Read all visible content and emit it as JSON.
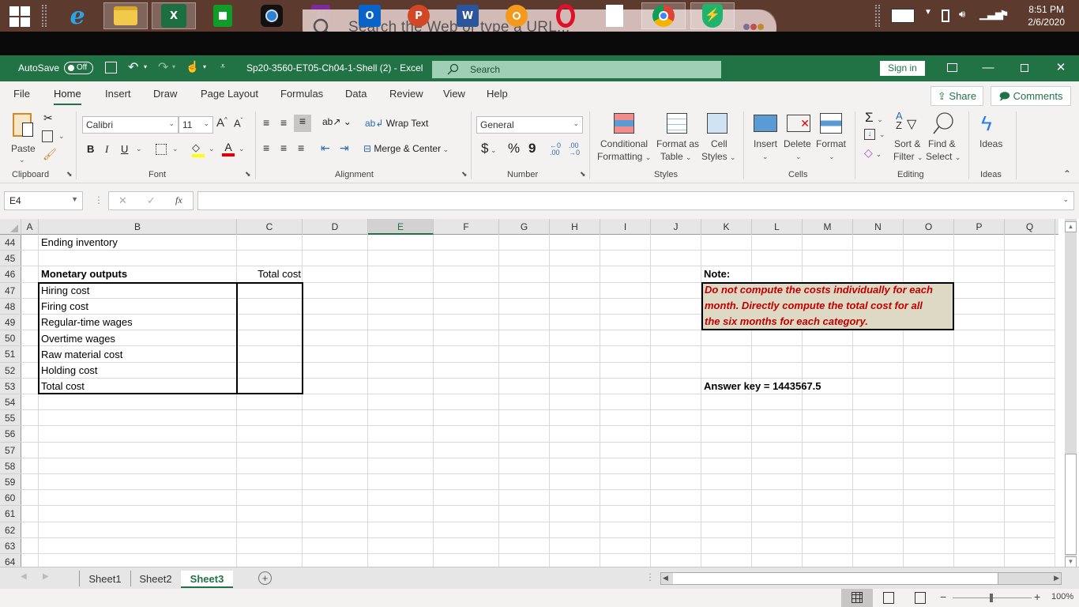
{
  "taskbar": {
    "apps": [
      {
        "name": "start",
        "label": ""
      },
      {
        "name": "internet-explorer",
        "label": "e"
      },
      {
        "name": "file-explorer",
        "label": ""
      },
      {
        "name": "excel",
        "label": "X"
      },
      {
        "name": "microsoft-store",
        "label": ""
      },
      {
        "name": "media-player",
        "label": ""
      },
      {
        "name": "onenote",
        "label": "N"
      },
      {
        "name": "outlook",
        "label": "O"
      },
      {
        "name": "powerpoint",
        "label": "P"
      },
      {
        "name": "word",
        "label": "W"
      },
      {
        "name": "helm-app",
        "label": ""
      },
      {
        "name": "opera",
        "label": "O"
      },
      {
        "name": "blank-file",
        "label": ""
      },
      {
        "name": "chrome",
        "label": ""
      },
      {
        "name": "shield-app",
        "label": ""
      }
    ],
    "web_search_placeholder": "Search the Web or type a URL...",
    "clock": {
      "time": "8:51 PM",
      "date": "2/6/2020"
    }
  },
  "titlebar": {
    "autosave_label": "AutoSave",
    "autosave_state": "Off",
    "document_title": "Sp20-3560-ET05-Ch04-1-Shell (2)  -  Excel",
    "search_placeholder": "Search",
    "sign_in": "Sign in"
  },
  "menu_tabs": [
    "File",
    "Home",
    "Insert",
    "Draw",
    "Page Layout",
    "Formulas",
    "Data",
    "Review",
    "View",
    "Help"
  ],
  "active_tab": "Home",
  "share_label": "Share",
  "comments_label": "Comments",
  "ribbon": {
    "clipboard": {
      "paste": "Paste",
      "group": "Clipboard"
    },
    "font": {
      "name": "Calibri",
      "size": "11",
      "bold": "B",
      "italic": "I",
      "underline": "U",
      "group": "Font"
    },
    "alignment": {
      "wrap_text": "Wrap Text",
      "merge_center": "Merge & Center",
      "group": "Alignment"
    },
    "number": {
      "format": "General",
      "currency": "$",
      "percent": "%",
      "comma": "9",
      "group": "Number"
    },
    "styles": {
      "conditional1": "Conditional",
      "conditional2": "Formatting",
      "format_table1": "Format as",
      "format_table2": "Table",
      "cell_styles1": "Cell",
      "cell_styles2": "Styles",
      "group": "Styles"
    },
    "cells": {
      "insert": "Insert",
      "delete": "Delete",
      "format": "Format",
      "group": "Cells"
    },
    "editing": {
      "sort1": "Sort &",
      "sort2": "Filter",
      "find1": "Find &",
      "find2": "Select",
      "group": "Editing"
    },
    "ideas": {
      "label": "Ideas",
      "group": "Ideas"
    }
  },
  "formula_bar": {
    "name_box": "E4",
    "formula": ""
  },
  "columns": [
    "A",
    "B",
    "C",
    "D",
    "E",
    "F",
    "G",
    "H",
    "I",
    "J",
    "K",
    "L",
    "M",
    "N",
    "O",
    "P",
    "Q"
  ],
  "selected_column": "E",
  "rows": [
    "44",
    "45",
    "46",
    "47",
    "48",
    "49",
    "50",
    "51",
    "52",
    "53",
    "54",
    "55",
    "56",
    "57",
    "58",
    "59",
    "60",
    "61",
    "62",
    "63",
    "64"
  ],
  "cells": {
    "B44": "Ending inventory",
    "B46": "Monetary outputs",
    "C46": "Total cost",
    "B47": "Hiring cost",
    "B48": "Firing cost",
    "B49": "Regular-time wages",
    "B50": "Overtime wages",
    "B51": "Raw material cost",
    "B52": "Holding cost",
    "B53": "Total cost",
    "K46": "Note:",
    "K53": "Answer key = 1443567.5"
  },
  "note_lines": [
    "Do not compute the costs individually for each",
    "month.  Directly compute the total cost for all",
    "the six months for each category."
  ],
  "sheets": [
    "Sheet1",
    "Sheet2",
    "Sheet3"
  ],
  "active_sheet": "Sheet3",
  "status": {
    "zoom": "100%"
  }
}
